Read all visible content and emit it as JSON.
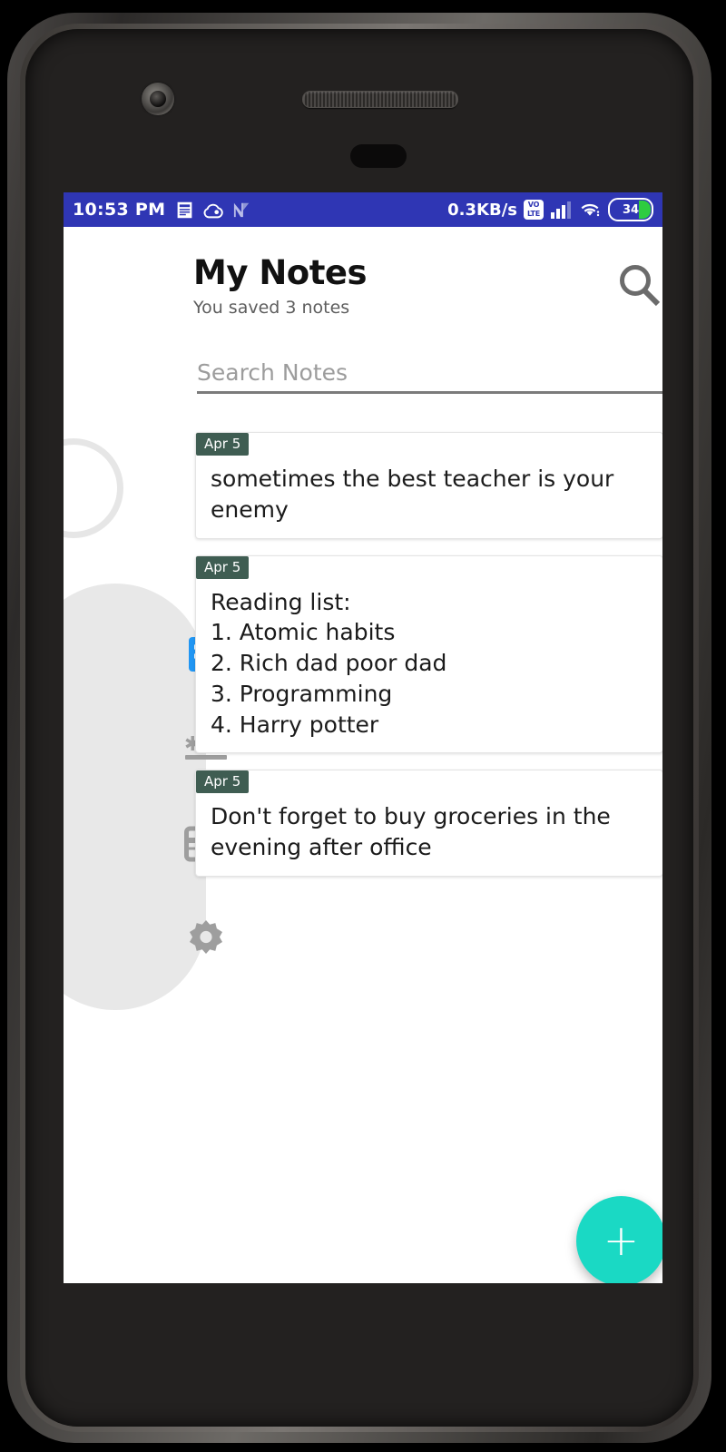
{
  "device": {
    "camera_icon": "camera-icon",
    "speaker_icon": "speaker-grille-icon",
    "notch_icon": "sensor-notch-icon"
  },
  "status_bar": {
    "time": "10:53 PM",
    "left_icons": [
      "sim-card-icon",
      "cloud-icon",
      "nfc-n-icon"
    ],
    "data_rate": "0.3KB/s",
    "volte_top": "VO",
    "volte_bottom": "LTE",
    "signal_icon": "signal-bars-icon",
    "wifi_icon": "wifi-icon",
    "battery_level": "34",
    "background_color": "#2f36b4",
    "battery_fill_color": "#2ecc40"
  },
  "header": {
    "title": "My Notes",
    "subtitle": "You saved 3 notes",
    "search_icon": "search-icon"
  },
  "search": {
    "value": "",
    "placeholder": "Search Notes"
  },
  "sidebar": {
    "items": [
      {
        "icon": "notes-icon",
        "active": true,
        "color": "#2196f3"
      },
      {
        "icon": "password-asterisks-icon",
        "active": false,
        "color": "#9e9e9e"
      },
      {
        "icon": "card-icon",
        "active": false,
        "color": "#9e9e9e"
      },
      {
        "icon": "settings-gear-icon",
        "active": false,
        "color": "#9e9e9e"
      }
    ],
    "background_color": "#e8e8e8"
  },
  "notes": [
    {
      "date": "Apr 5",
      "text": "sometimes the best teacher is your enemy"
    },
    {
      "date": "Apr 5",
      "text": "Reading list:\n1. Atomic habits\n2. Rich dad poor dad\n3. Programming\n4. Harry potter"
    },
    {
      "date": "Apr 5",
      "text": "Don't forget to buy groceries in the evening after office"
    }
  ],
  "fab": {
    "label": "+",
    "icon": "plus-icon",
    "color": "#1ad9c4"
  },
  "theme": {
    "badge_color": "#3f5d52",
    "accent": "#1ad9c4"
  }
}
